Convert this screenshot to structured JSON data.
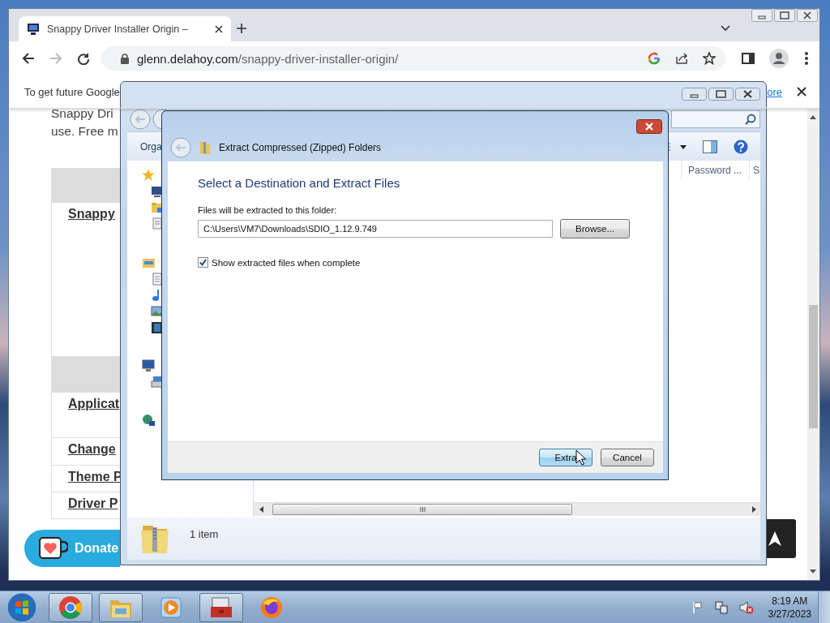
{
  "browser": {
    "tab": {
      "title": "Snappy Driver Installer Origin –"
    },
    "address": {
      "host": "glenn.delahoy.com",
      "path": "/snappy-driver-installer-origin/"
    },
    "infobar": {
      "text": "To get future Google",
      "link": "ore"
    },
    "page": {
      "intro": [
        "Snappy Dri",
        "use. Free m"
      ],
      "table_rows": [
        {
          "kind": "heading"
        },
        {
          "kind": "link",
          "text": "Snappy"
        },
        {
          "kind": "heading"
        },
        {
          "kind": "link",
          "text": "Applicat"
        },
        {
          "kind": "link",
          "text": "Change"
        },
        {
          "kind": "link",
          "text": "Theme P"
        },
        {
          "kind": "link",
          "text": "Driver P"
        }
      ],
      "donate": "Donate"
    }
  },
  "explorer": {
    "toolbar": {
      "organize": "Orga"
    },
    "columns": [
      "Password ...",
      "Si"
    ],
    "status": "1 item"
  },
  "dialog": {
    "title": "Extract Compressed (Zipped) Folders",
    "heading": "Select a Destination and Extract Files",
    "field_label": "Files will be extracted to this folder:",
    "path": "C:\\Users\\VM7\\Downloads\\SDIO_1.12.9.749",
    "browse": "Browse...",
    "show_files": {
      "label": "Show extracted files when complete",
      "checked": true
    },
    "buttons": [
      {
        "label": "Extra",
        "default": true
      },
      {
        "label": "Cancel",
        "default": false
      }
    ]
  },
  "taskbar": {
    "apps": [
      {
        "kind": "chrome",
        "running": true
      },
      {
        "kind": "explorer",
        "running": true
      },
      {
        "kind": "media",
        "running": false
      },
      {
        "kind": "toolbox",
        "running": true
      },
      {
        "kind": "firefox",
        "running": false
      }
    ],
    "clock": {
      "time": "8:19 AM",
      "date": "3/27/2023"
    }
  }
}
